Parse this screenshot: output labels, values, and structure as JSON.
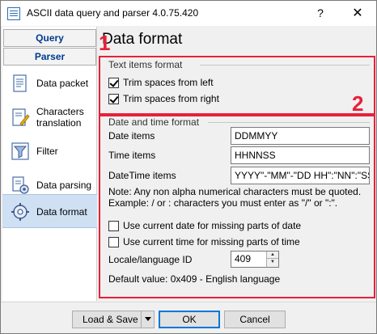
{
  "window": {
    "title": "ASCII data query and parser 4.0.75.420",
    "help_label": "?",
    "close_label": "✕"
  },
  "sidebar": {
    "tabs": [
      {
        "label": "Query"
      },
      {
        "label": "Parser"
      }
    ],
    "items": [
      {
        "label": "Data packet",
        "icon": "data-packet-icon"
      },
      {
        "label": "Characters translation",
        "icon": "characters-translation-icon"
      },
      {
        "label": "Filter",
        "icon": "filter-icon"
      },
      {
        "label": "Data parsing",
        "icon": "data-parsing-icon"
      },
      {
        "label": "Data format",
        "icon": "data-format-icon",
        "selected": true
      }
    ]
  },
  "page": {
    "title": "Data format"
  },
  "annotations": {
    "box1_number": "1",
    "box2_number": "2",
    "color": "#e8203a"
  },
  "text_items": {
    "group_label": "Text items format",
    "trim_left": {
      "label": "Trim spaces from left",
      "checked": true
    },
    "trim_right": {
      "label": "Trim spaces from right",
      "checked": true
    }
  },
  "date_time": {
    "group_label": "Date and time format",
    "date_items": {
      "label": "Date items",
      "value": "DDMMYY"
    },
    "time_items": {
      "label": "Time items",
      "value": "HHNNSS"
    },
    "datetime_items": {
      "label": "DateTime items",
      "value": "YYYY\"-\"MM\"-\"DD HH\":\"NN\":\"SS"
    },
    "note_line1": "Note: Any non alpha numerical characters must be quoted.",
    "note_line2": "Example: / or : characters you must enter as \"/\" or \":\".",
    "use_current_date": {
      "label": "Use current date for missing parts of date",
      "checked": false
    },
    "use_current_time": {
      "label": "Use current time for missing parts of time",
      "checked": false
    },
    "locale_label": "Locale/language ID",
    "locale_value": "409",
    "default_value": "Default value: 0x409 - English language"
  },
  "buttons": {
    "load_save": "Load & Save",
    "ok": "OK",
    "cancel": "Cancel"
  }
}
